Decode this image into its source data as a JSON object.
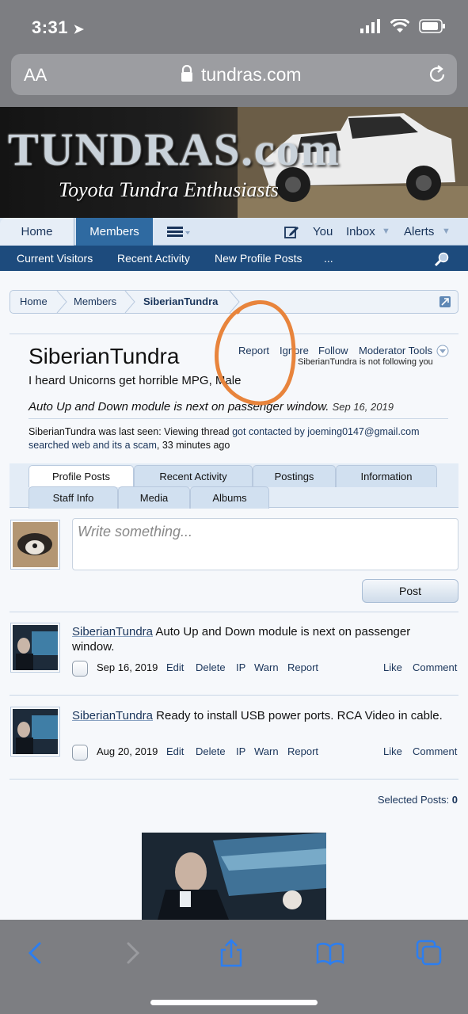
{
  "status_bar": {
    "time": "3:31"
  },
  "url_bar": {
    "text_size": "AA",
    "domain": "tundras.com"
  },
  "banner": {
    "logo": "TUNDRAS.com",
    "tagline": "Toyota Tundra Enthusiasts"
  },
  "nav": {
    "home": "Home",
    "members": "Members",
    "you": "You",
    "inbox": "Inbox",
    "alerts": "Alerts",
    "subnav": [
      "Current Visitors",
      "Recent Activity",
      "New Profile Posts",
      "..."
    ]
  },
  "breadcrumb": [
    "Home",
    "Members",
    "SiberianTundra"
  ],
  "profile": {
    "username": "SiberianTundra",
    "links": [
      "Report",
      "Ignore",
      "Follow",
      "Moderator Tools"
    ],
    "not_following": "SiberianTundra is not following you",
    "title": "I heard Unicorns get horrible MPG, Male",
    "status": "Auto Up and Down module is next on passenger window.",
    "status_date": "Sep 16, 2019",
    "last_seen_prefix": "SiberianTundra was last seen: Viewing thread ",
    "last_seen_thread": "got contacted by joeming0147@gmail.com searched web and its a scam",
    "last_seen_suffix": ", 33 minutes ago"
  },
  "tabs": [
    "Profile Posts",
    "Recent Activity",
    "Postings",
    "Information",
    "Staff Info",
    "Media",
    "Albums"
  ],
  "composer": {
    "placeholder": "Write something...",
    "post_label": "Post"
  },
  "posts": [
    {
      "author": "SiberianTundra",
      "text": " Auto Up and Down module is next on passenger window.",
      "date": "Sep 16, 2019",
      "actions": [
        "Edit",
        "Delete",
        "IP",
        "Warn",
        "Report"
      ],
      "right_actions": [
        "Like",
        "Comment"
      ]
    },
    {
      "author": "SiberianTundra",
      "text": " Ready to install USB power ports. RCA Video in cable.",
      "date": "Aug 20, 2019",
      "actions": [
        "Edit",
        "Delete",
        "IP",
        "Warn",
        "Report"
      ],
      "right_actions": [
        "Like",
        "Comment"
      ]
    }
  ],
  "selected_posts": {
    "label": "Selected Posts:",
    "count": "0"
  },
  "colors": {
    "link": "#19345a",
    "nav_active": "#2f6aa1",
    "subnav": "#1d4b7d",
    "annotation_circle": "#e8843c"
  }
}
